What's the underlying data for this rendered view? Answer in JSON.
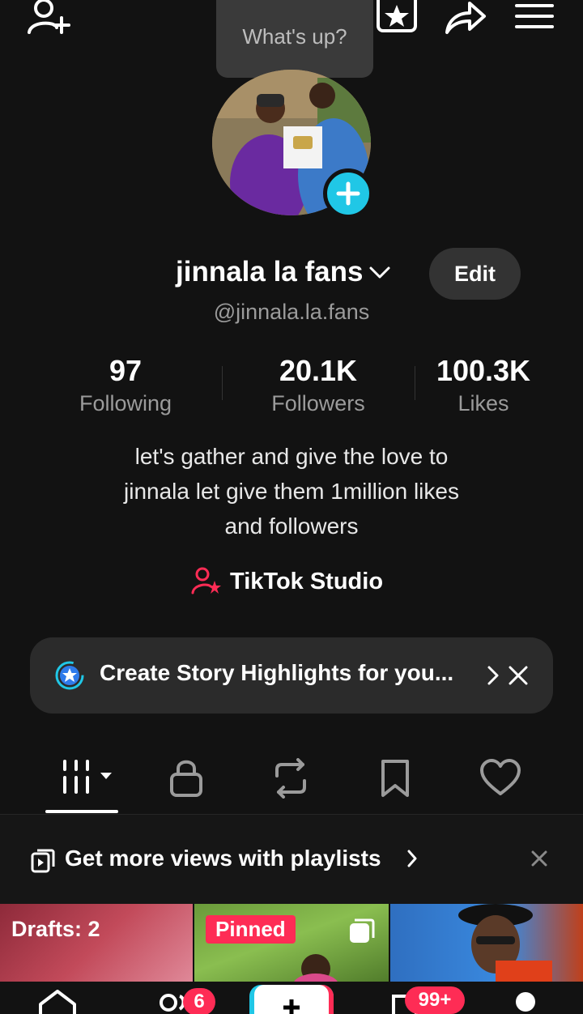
{
  "header": {
    "tooltip": "What's up?"
  },
  "profile": {
    "name": "jinnala la fans",
    "handle": "@jinnala.la.fans",
    "edit_label": "Edit",
    "stats": [
      {
        "value": "97",
        "label": "Following"
      },
      {
        "value": "20.1K",
        "label": "Followers"
      },
      {
        "value": "100.3K",
        "label": "Likes"
      }
    ],
    "bio_lines": [
      "let's gather and give the love to",
      "jinnala let give them 1million likes",
      "and followers"
    ],
    "studio_label": "TikTok Studio"
  },
  "highlights_banner": {
    "text": "Create Story Highlights for you..."
  },
  "tabs": [
    "videos-grid",
    "private",
    "reposts",
    "favorites",
    "liked"
  ],
  "playlist_banner": {
    "text": "Get more views with playlists"
  },
  "grid": {
    "drafts_label": "Drafts: 2",
    "pinned_label": "Pinned"
  },
  "bottom_nav": {
    "friends_badge": "6",
    "inbox_badge": "99+"
  },
  "colors": {
    "background": "#121212",
    "accent_cyan": "#20c7e6",
    "accent_red": "#fe2c55",
    "card": "#2b2b2b"
  },
  "icons": [
    "add-friend-icon",
    "favorites-star-icon",
    "share-icon",
    "menu-icon",
    "add-story-icon",
    "studio-icon",
    "highlight-star-icon",
    "chevron-right-icon",
    "close-icon",
    "grid-icon",
    "lock-icon",
    "repost-icon",
    "bookmark-icon",
    "heart-icon",
    "playlist-icon",
    "home-icon",
    "friends-icon",
    "create-icon",
    "inbox-icon",
    "profile-icon"
  ]
}
